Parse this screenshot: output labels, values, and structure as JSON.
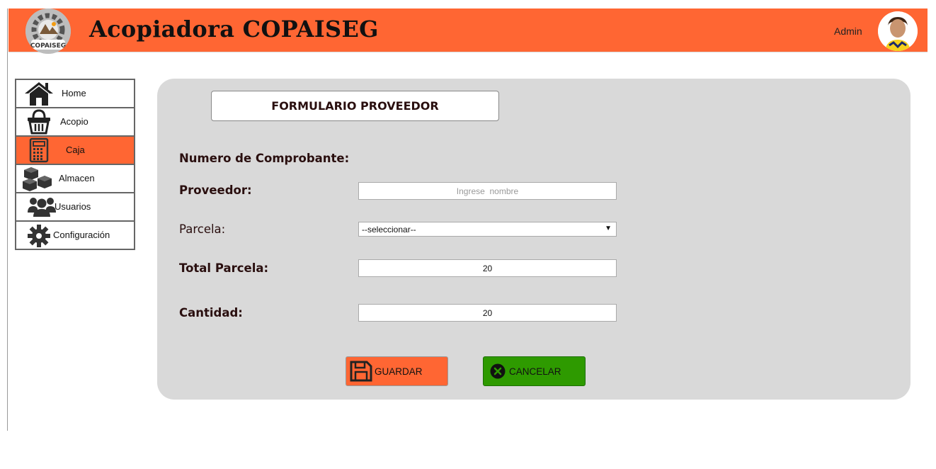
{
  "header": {
    "title": "Acopiadora COPAISEG",
    "logo_text": "COPAISEG",
    "user": "Admin",
    "color": "#ff6633"
  },
  "sidebar": {
    "items": [
      {
        "label": "Home",
        "icon": "home-icon",
        "active": false
      },
      {
        "label": "Acopio",
        "icon": "basket-icon",
        "active": false
      },
      {
        "label": "Caja",
        "icon": "calculator-icon",
        "active": true
      },
      {
        "label": "Almacen",
        "icon": "boxes-icon",
        "active": false
      },
      {
        "label": "Usuarios",
        "icon": "users-icon",
        "active": false
      },
      {
        "label": "Configuración",
        "icon": "gear-icon",
        "active": false
      }
    ]
  },
  "form": {
    "title": "FORMULARIO PROVEEDOR",
    "comprobante_label": "Numero de Comprobante:",
    "proveedor_label": "Proveedor:",
    "proveedor_placeholder": "Ingrese  nombre",
    "parcela_label": "Parcela:",
    "parcela_selected": "--seleccionar--",
    "total_parcela_label": "Total Parcela:",
    "total_parcela_value": "20",
    "cantidad_label": "Cantidad:",
    "cantidad_value": "20"
  },
  "buttons": {
    "save": "GUARDAR",
    "cancel": "CANCELAR"
  },
  "colors": {
    "accent": "#ff6633",
    "panel": "#d9d9d9",
    "cancel": "#2e9a00"
  }
}
